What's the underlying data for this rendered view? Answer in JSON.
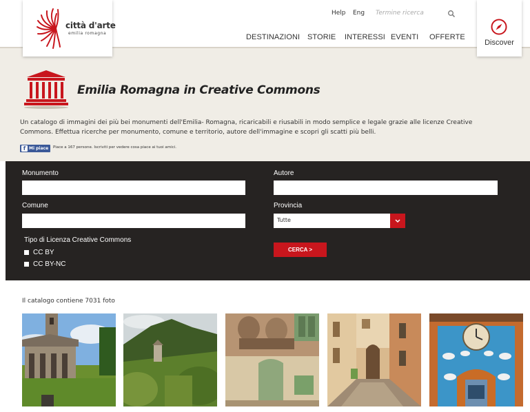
{
  "brand": {
    "name": "città d'arte",
    "tagline": "emilia romagna"
  },
  "utility": {
    "help": "Help",
    "lang": "Eng",
    "search_placeholder": "Termine ricerca"
  },
  "nav": [
    "DESTINAZIONI",
    "STORIE",
    "INTERESSI",
    "EVENTI",
    "OFFERTE"
  ],
  "discover": {
    "label": "Discover"
  },
  "intro": {
    "title": "Emilia Romagna in Creative Commons",
    "description": "Un catalogo di immagini dei più bei monumenti dell'Emilia- Romagna, ricaricabili e riusabili in modo semplice e legale grazie alle licenze Creative Commons. Effettua ricerche per monumento, comune e territorio, autore dell'immagine e scopri gli scatti più belli.",
    "fb_like": "Mi piace",
    "fb_text": "Piace a 167 persone. Iscriviti per vedere cosa piace ai tuoi amici."
  },
  "form": {
    "monumento_label": "Monumento",
    "autore_label": "Autore",
    "comune_label": "Comune",
    "provincia_label": "Provincia",
    "provincia_value": "Tutte",
    "licenza_label": "Tipo di Licenza Creative Commons",
    "licenses": [
      "CC BY",
      "CC BY-NC"
    ],
    "submit_label": "CERCA >"
  },
  "catalog": {
    "count_text": "Il catalogo contiene 7031 foto",
    "photos": [
      "church-tower-photo",
      "mountain-chapel-photo",
      "painted-wall-photo",
      "village-street-photo",
      "clock-fresco-photo"
    ]
  },
  "colors": {
    "accent": "#c8161d",
    "panel": "#262322",
    "intro_bg": "#f0ede6",
    "facebook": "#3b5998"
  }
}
